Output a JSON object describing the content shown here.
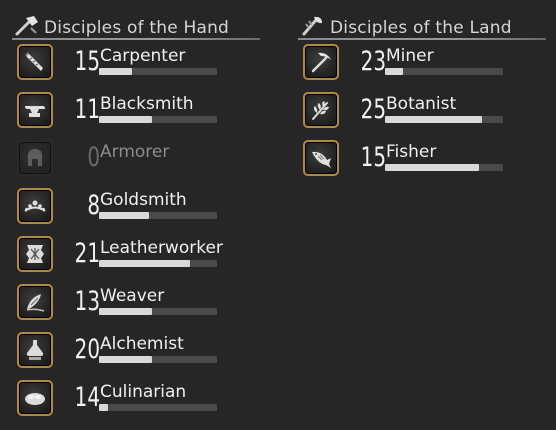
{
  "sections": {
    "hand": {
      "title": "Disciples of the Hand",
      "icon": "hammer-icon",
      "jobs": [
        {
          "name": "Carpenter",
          "level": "15",
          "progress": 0.28,
          "icon": "saw-icon",
          "locked": false
        },
        {
          "name": "Blacksmith",
          "level": "11",
          "progress": 0.45,
          "icon": "anvil-icon",
          "locked": false
        },
        {
          "name": "Armorer",
          "level": "0",
          "progress": 0,
          "icon": "helmet-icon",
          "locked": true
        },
        {
          "name": "Goldsmith",
          "level": "8",
          "progress": 0.42,
          "icon": "tiara-icon",
          "locked": false
        },
        {
          "name": "Leatherworker",
          "level": "21",
          "progress": 0.77,
          "icon": "hide-icon",
          "locked": false
        },
        {
          "name": "Weaver",
          "level": "13",
          "progress": 0.45,
          "icon": "needle-icon",
          "locked": false
        },
        {
          "name": "Alchemist",
          "level": "20",
          "progress": 0.45,
          "icon": "flask-icon",
          "locked": false
        },
        {
          "name": "Culinarian",
          "level": "14",
          "progress": 0.08,
          "icon": "bread-icon",
          "locked": false
        }
      ]
    },
    "land": {
      "title": "Disciples of the Land",
      "icon": "leaf-tool-icon",
      "jobs": [
        {
          "name": "Miner",
          "level": "23",
          "progress": 0.15,
          "icon": "pickaxe-icon",
          "locked": false
        },
        {
          "name": "Botanist",
          "level": "25",
          "progress": 0.82,
          "icon": "hatchet-icon",
          "locked": false
        },
        {
          "name": "Fisher",
          "level": "15",
          "progress": 0.8,
          "icon": "fish-icon",
          "locked": false
        }
      ]
    }
  },
  "colors": {
    "background": "#262626",
    "icon_frame": "#b08a3e",
    "bar_track": "#4a4a4a",
    "bar_fill": "#d9d9d9"
  }
}
